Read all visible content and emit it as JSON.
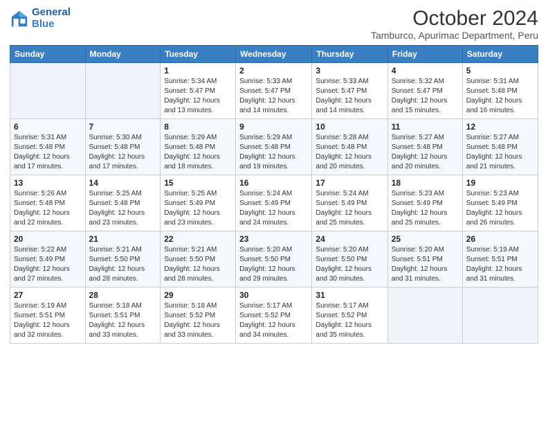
{
  "logo": {
    "line1": "General",
    "line2": "Blue"
  },
  "title": "October 2024",
  "subtitle": "Tamburco, Apurimac Department, Peru",
  "days_of_week": [
    "Sunday",
    "Monday",
    "Tuesday",
    "Wednesday",
    "Thursday",
    "Friday",
    "Saturday"
  ],
  "weeks": [
    [
      {
        "day": "",
        "info": ""
      },
      {
        "day": "",
        "info": ""
      },
      {
        "day": "1",
        "info": "Sunrise: 5:34 AM\nSunset: 5:47 PM\nDaylight: 12 hours and 13 minutes."
      },
      {
        "day": "2",
        "info": "Sunrise: 5:33 AM\nSunset: 5:47 PM\nDaylight: 12 hours and 14 minutes."
      },
      {
        "day": "3",
        "info": "Sunrise: 5:33 AM\nSunset: 5:47 PM\nDaylight: 12 hours and 14 minutes."
      },
      {
        "day": "4",
        "info": "Sunrise: 5:32 AM\nSunset: 5:47 PM\nDaylight: 12 hours and 15 minutes."
      },
      {
        "day": "5",
        "info": "Sunrise: 5:31 AM\nSunset: 5:48 PM\nDaylight: 12 hours and 16 minutes."
      }
    ],
    [
      {
        "day": "6",
        "info": "Sunrise: 5:31 AM\nSunset: 5:48 PM\nDaylight: 12 hours and 17 minutes."
      },
      {
        "day": "7",
        "info": "Sunrise: 5:30 AM\nSunset: 5:48 PM\nDaylight: 12 hours and 17 minutes."
      },
      {
        "day": "8",
        "info": "Sunrise: 5:29 AM\nSunset: 5:48 PM\nDaylight: 12 hours and 18 minutes."
      },
      {
        "day": "9",
        "info": "Sunrise: 5:29 AM\nSunset: 5:48 PM\nDaylight: 12 hours and 19 minutes."
      },
      {
        "day": "10",
        "info": "Sunrise: 5:28 AM\nSunset: 5:48 PM\nDaylight: 12 hours and 20 minutes."
      },
      {
        "day": "11",
        "info": "Sunrise: 5:27 AM\nSunset: 5:48 PM\nDaylight: 12 hours and 20 minutes."
      },
      {
        "day": "12",
        "info": "Sunrise: 5:27 AM\nSunset: 5:48 PM\nDaylight: 12 hours and 21 minutes."
      }
    ],
    [
      {
        "day": "13",
        "info": "Sunrise: 5:26 AM\nSunset: 5:48 PM\nDaylight: 12 hours and 22 minutes."
      },
      {
        "day": "14",
        "info": "Sunrise: 5:25 AM\nSunset: 5:48 PM\nDaylight: 12 hours and 23 minutes."
      },
      {
        "day": "15",
        "info": "Sunrise: 5:25 AM\nSunset: 5:49 PM\nDaylight: 12 hours and 23 minutes."
      },
      {
        "day": "16",
        "info": "Sunrise: 5:24 AM\nSunset: 5:49 PM\nDaylight: 12 hours and 24 minutes."
      },
      {
        "day": "17",
        "info": "Sunrise: 5:24 AM\nSunset: 5:49 PM\nDaylight: 12 hours and 25 minutes."
      },
      {
        "day": "18",
        "info": "Sunrise: 5:23 AM\nSunset: 5:49 PM\nDaylight: 12 hours and 25 minutes."
      },
      {
        "day": "19",
        "info": "Sunrise: 5:23 AM\nSunset: 5:49 PM\nDaylight: 12 hours and 26 minutes."
      }
    ],
    [
      {
        "day": "20",
        "info": "Sunrise: 5:22 AM\nSunset: 5:49 PM\nDaylight: 12 hours and 27 minutes."
      },
      {
        "day": "21",
        "info": "Sunrise: 5:21 AM\nSunset: 5:50 PM\nDaylight: 12 hours and 28 minutes."
      },
      {
        "day": "22",
        "info": "Sunrise: 5:21 AM\nSunset: 5:50 PM\nDaylight: 12 hours and 28 minutes."
      },
      {
        "day": "23",
        "info": "Sunrise: 5:20 AM\nSunset: 5:50 PM\nDaylight: 12 hours and 29 minutes."
      },
      {
        "day": "24",
        "info": "Sunrise: 5:20 AM\nSunset: 5:50 PM\nDaylight: 12 hours and 30 minutes."
      },
      {
        "day": "25",
        "info": "Sunrise: 5:20 AM\nSunset: 5:51 PM\nDaylight: 12 hours and 31 minutes."
      },
      {
        "day": "26",
        "info": "Sunrise: 5:19 AM\nSunset: 5:51 PM\nDaylight: 12 hours and 31 minutes."
      }
    ],
    [
      {
        "day": "27",
        "info": "Sunrise: 5:19 AM\nSunset: 5:51 PM\nDaylight: 12 hours and 32 minutes."
      },
      {
        "day": "28",
        "info": "Sunrise: 5:18 AM\nSunset: 5:51 PM\nDaylight: 12 hours and 33 minutes."
      },
      {
        "day": "29",
        "info": "Sunrise: 5:18 AM\nSunset: 5:52 PM\nDaylight: 12 hours and 33 minutes."
      },
      {
        "day": "30",
        "info": "Sunrise: 5:17 AM\nSunset: 5:52 PM\nDaylight: 12 hours and 34 minutes."
      },
      {
        "day": "31",
        "info": "Sunrise: 5:17 AM\nSunset: 5:52 PM\nDaylight: 12 hours and 35 minutes."
      },
      {
        "day": "",
        "info": ""
      },
      {
        "day": "",
        "info": ""
      }
    ]
  ]
}
